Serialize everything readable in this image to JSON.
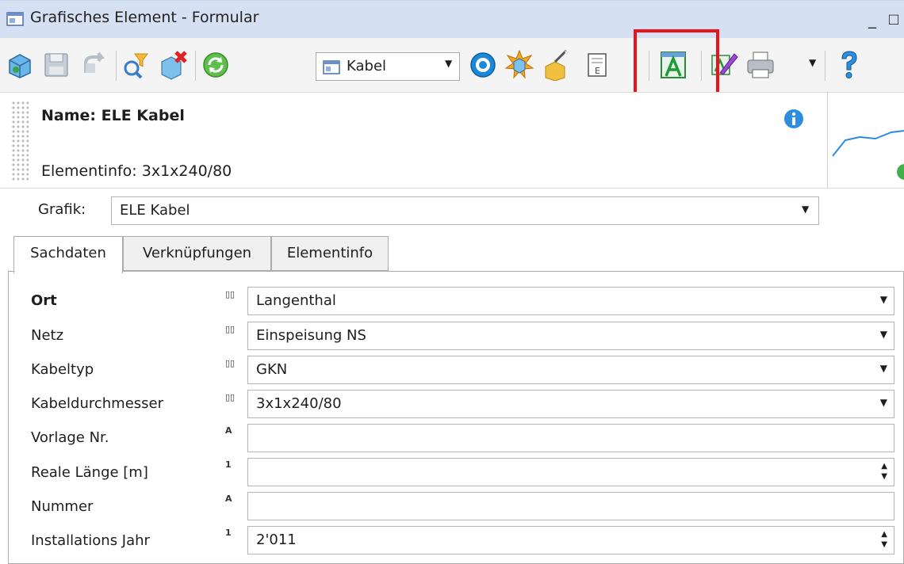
{
  "window": {
    "title": "Grafisches Element - Formular",
    "minimize": "_",
    "maximize": "□"
  },
  "toolbar": {
    "layer_select": {
      "value": "Kabel"
    },
    "icons": [
      "globe-icon",
      "save-icon",
      "undo-icon",
      "filter-icon",
      "delete-icon",
      "refresh-icon",
      "target-icon",
      "explode-icon",
      "magic-wand-icon",
      "document-icon",
      "edit-graphic-icon",
      "edit-pen-icon",
      "print-icon",
      "help-icon"
    ],
    "highlight_color": "#e8131b"
  },
  "header": {
    "name": "Name:  ELE Kabel",
    "elementinfo": "Elementinfo: 3x1x240/80"
  },
  "grafik": {
    "label": "Grafik:",
    "value": "ELE Kabel"
  },
  "tabs": [
    {
      "label": "Sachdaten",
      "active": true
    },
    {
      "label": "Verknüpfungen",
      "active": false
    },
    {
      "label": "Elementinfo",
      "active": false
    }
  ],
  "form": {
    "rows": [
      {
        "label": "Ort",
        "bold": true,
        "type_glyph": "ꟷ",
        "value": "Langenthal",
        "control": "dropdown"
      },
      {
        "label": "Netz",
        "type_glyph": "ꟷ",
        "value": "Einspeisung NS",
        "control": "dropdown"
      },
      {
        "label": "Kabeltyp",
        "type_glyph": "ꟷ",
        "value": "GKN",
        "control": "dropdown"
      },
      {
        "label": "Kabeldurchmesser",
        "type_glyph": "ꟷ",
        "value": "3x1x240/80",
        "control": "dropdown"
      },
      {
        "label": "Vorlage Nr.",
        "type_glyph": "A",
        "value": "",
        "control": "text"
      },
      {
        "label": "Reale Länge [m]",
        "type_glyph": "1",
        "value": "",
        "control": "spin"
      },
      {
        "label": "Nummer",
        "type_glyph": "A",
        "value": "",
        "control": "text"
      },
      {
        "label": "Installations Jahr",
        "type_glyph": "1",
        "value": "2'011",
        "control": "spin"
      }
    ]
  },
  "colors": {
    "titlebar": "#d5e1f2",
    "toolbar": "#f4f4f4",
    "highlight": "#e8131b"
  }
}
